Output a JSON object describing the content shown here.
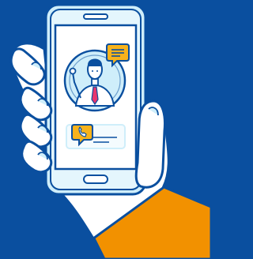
{
  "colors": {
    "background": "#0a4f9f",
    "outline": "#0a4f9f",
    "hand": "#ffffff",
    "sleeve": "#f29100",
    "phone_body": "#cfeefa",
    "phone_frame": "#e4f6fd",
    "phone_screen": "#ffffff",
    "screen_panel": "#f4fbfe",
    "avatar_circle": "#cfeefa",
    "accent_yellow": "#f7b21b",
    "tie": "#e8346d",
    "skin": "#ffffff"
  },
  "icons": {
    "chat": "chat-bubble-icon",
    "phone": "phone-call-icon",
    "person": "person-avatar-icon"
  }
}
